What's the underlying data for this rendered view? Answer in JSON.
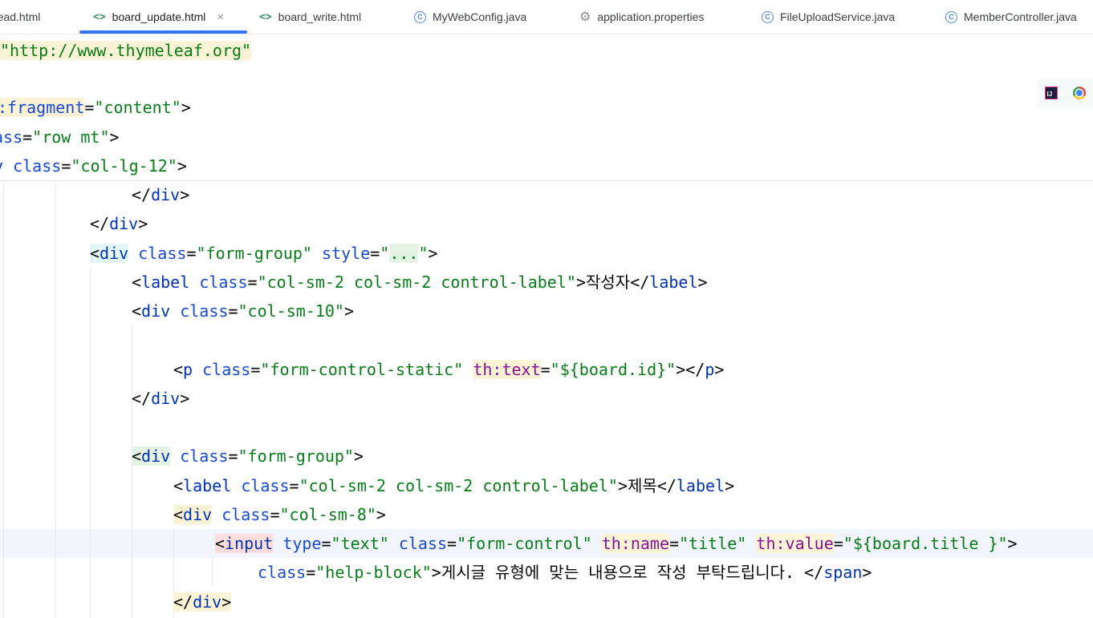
{
  "tabs": [
    {
      "label": "read.html",
      "icon": "html-file-icon",
      "active": false
    },
    {
      "label": "board_update.html",
      "icon": "html-file-icon",
      "active": true
    },
    {
      "label": "board_write.html",
      "icon": "html-file-icon",
      "active": false
    },
    {
      "label": "MyWebConfig.java",
      "icon": "java-class-icon",
      "active": false
    },
    {
      "label": "application.properties",
      "icon": "gear-icon",
      "active": false
    },
    {
      "label": "FileUploadService.java",
      "icon": "java-class-icon",
      "active": false
    },
    {
      "label": "MemberController.java",
      "icon": "java-class-icon",
      "active": false
    }
  ],
  "tab_close_glyph": "×",
  "browser_icons": [
    "intellij-icon",
    "chrome-icon"
  ],
  "sticky_lines": {
    "l1": {
      "s1": "\"http://www.thymeleaf.org\""
    },
    "l2": {
      "a1": ":fragment",
      "eq": "=",
      "s1": "\"content\"",
      "p1": ">"
    },
    "l3": {
      "a1": "ass",
      "eq": "=",
      "s1": "\"row mt\"",
      "p1": ">"
    },
    "l4": {
      "t1": "v",
      "a1": "class",
      "eq": "=",
      "s1": "\"col-lg-12\"",
      "p1": ">"
    }
  },
  "lines": {
    "l5": {
      "p1": "</",
      "t1": "div",
      "p2": ">"
    },
    "l6": {
      "p1": "</",
      "t1": "div",
      "p2": ">"
    },
    "l7": {
      "p1": "<",
      "t1": "div",
      "a1": "class",
      "eq1": "=",
      "s1": "\"form-group\"",
      "a2": "style",
      "eq2": "=",
      "s2a": "\"",
      "s2b": "...",
      "s2c": "\"",
      "p2": ">"
    },
    "l8": {
      "p1": "<",
      "t1": "label",
      "a1": "class",
      "eq1": "=",
      "s1": "\"col-sm-2 col-sm-2 control-label\"",
      "p2": ">",
      "x1": "작성자",
      "p3": "</",
      "t2": "label",
      "p4": ">"
    },
    "l9": {
      "p1": "<",
      "t1": "div",
      "a1": "class",
      "eq1": "=",
      "s1": "\"col-sm-10\"",
      "p2": ">"
    },
    "l11": {
      "p1": "<",
      "t1": "p",
      "a1": "class",
      "eq1": "=",
      "s1": "\"form-control-static\"",
      "a2": "th:text",
      "eq2": "=",
      "s2": "\"${board.id}\"",
      "p2": "></",
      "t2": "p",
      "p3": ">"
    },
    "l12": {
      "p1": "</",
      "t1": "div",
      "p2": ">"
    },
    "l14": {
      "p1": "<",
      "t1": "div",
      "a1": "class",
      "eq1": "=",
      "s1": "\"form-group\"",
      "p2": ">"
    },
    "l15": {
      "p1": "<",
      "t1": "label",
      "a1": "class",
      "eq1": "=",
      "s1": "\"col-sm-2 col-sm-2 control-label\"",
      "p2": ">",
      "x1": "제목",
      "p3": "</",
      "t2": "label",
      "p4": ">"
    },
    "l16": {
      "p1": "<",
      "t1": "div",
      "a1": "class",
      "eq1": "=",
      "s1": "\"col-sm-8\"",
      "p2": ">"
    },
    "l17": {
      "p1": "<",
      "t1": "input",
      "a1": "type",
      "eq1": "=",
      "s1": "\"text\"",
      "a2": "class",
      "eq2": "=",
      "s2": "\"form-control\"",
      "a3": "th:name",
      "eq3": "=",
      "s3": "\"title\"",
      "a4": "th:value",
      "eq4": "=",
      "s4": "\"${board.title }\"",
      "p2": ">"
    },
    "l18": {
      "a1": "class",
      "eq1": "=",
      "s1": "\"help-block\"",
      "p1": ">",
      "x1": "게시글 유형에 맞는 내용으로 작성 부탁드립니다. ",
      "p2": "</",
      "t1": "span",
      "p3": ">"
    },
    "l19": {
      "p1": "</",
      "t1": "div",
      "p2": ">"
    }
  }
}
